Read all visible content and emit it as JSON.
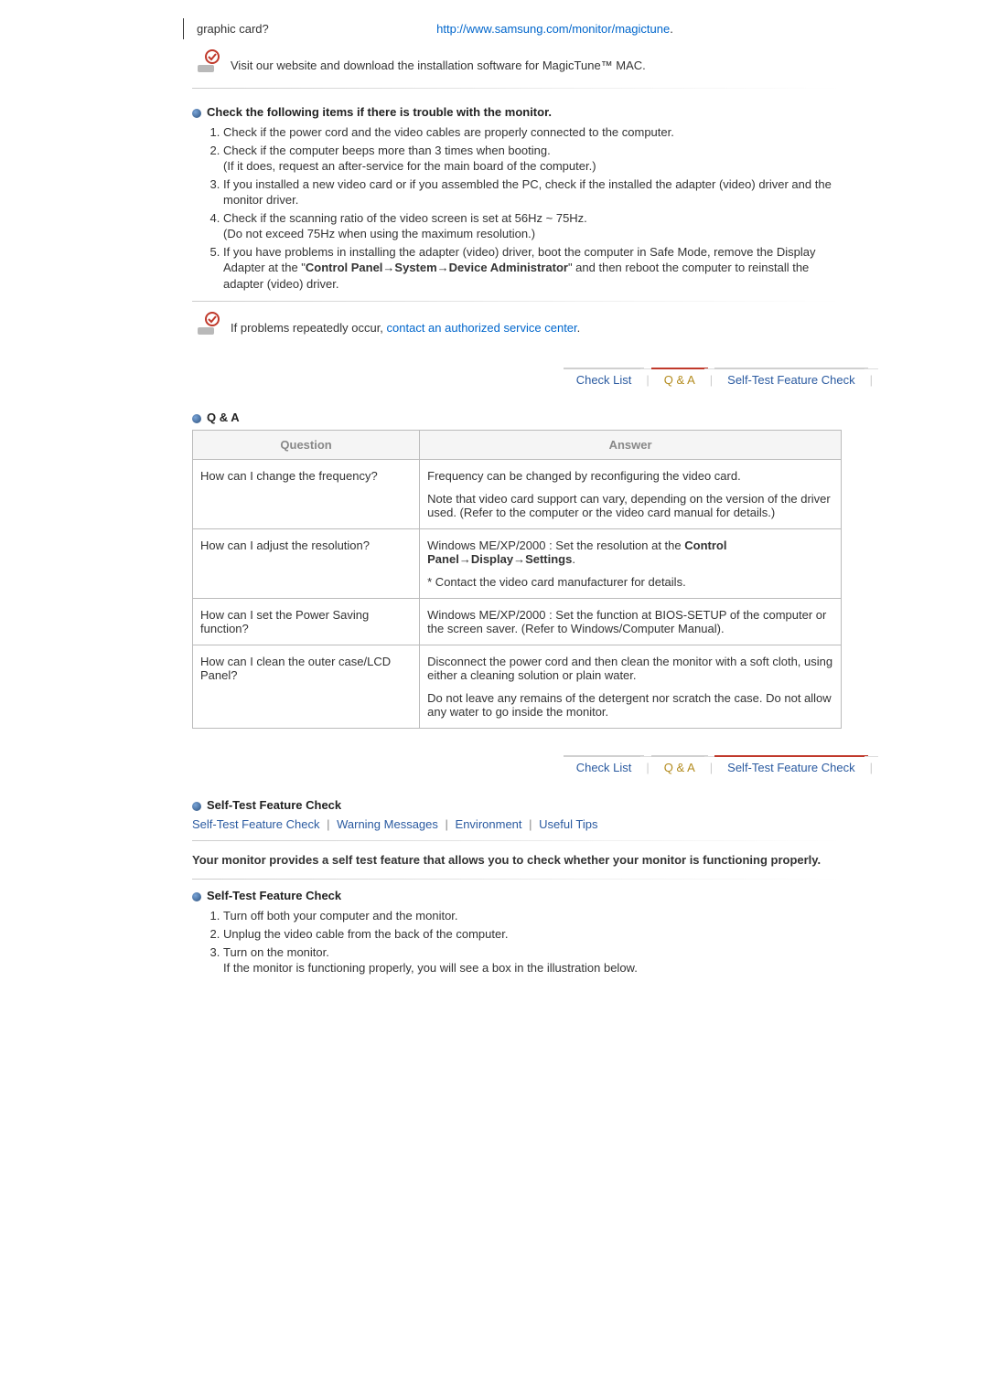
{
  "top_row": {
    "left": "graphic card?",
    "link": "http://www.samsung.com/monitor/magictune",
    "trail": "."
  },
  "mac_note": "Visit our website and download the installation software for MagicTune™ MAC.",
  "check_section": {
    "title": "Check the following items if there is trouble with the monitor.",
    "items": [
      "Check if the power cord and the video cables are properly connected to the computer.",
      "Check if the computer beeps more than 3 times when booting.\n(If it does, request an after-service for the main board of the computer.)",
      "If you installed a new video card or if you assembled the PC, check if the installed the adapter (video) driver and the monitor driver.",
      "Check if the scanning ratio of the video screen is set at 56Hz ~ 75Hz.\n(Do not exceed 75Hz when using the maximum resolution.)",
      "If you have problems in installing the adapter (video) driver, boot the computer in Safe Mode, remove the Display Adapter at the \"Control Panel→System→Device Administrator\" and then reboot the computer to reinstall the adapter (video) driver."
    ],
    "item5_prefix": "If you have problems in installing the adapter (video) driver, boot the computer in Safe Mode, remove the Display Adapter at the \"",
    "item5_bold": "Control Panel→System→Device Administrator",
    "item5_suffix": "\" and then reboot the computer to reinstall the adapter (video) driver."
  },
  "repeat_note_prefix": "If problems repeatedly occur, ",
  "repeat_note_link": "contact an authorized service center",
  "repeat_note_suffix": ".",
  "tabs": {
    "check_list": "Check List",
    "qa": "Q & A",
    "self_test": "Self-Test Feature Check"
  },
  "qa": {
    "title": "Q & A",
    "headers": {
      "q": "Question",
      "a": "Answer"
    },
    "rows": [
      {
        "q": "How can I change the frequency?",
        "a1": "Frequency can be changed by reconfiguring the video card.",
        "a2": "Note that video card support can vary, depending on the version of the driver used. (Refer to the computer or the video card manual for details.)"
      },
      {
        "q": "How can I adjust the resolution?",
        "a1_prefix": "Windows ME/XP/2000 : Set the resolution at the ",
        "a1_bold": "Control Panel→Display→Settings",
        "a1_suffix": ".",
        "a2": "* Contact the video card manufacturer for details."
      },
      {
        "q": "How can I set the Power Saving function?",
        "a1": "Windows ME/XP/2000 : Set the function at BIOS-SETUP of the computer or the screen saver. (Refer to Windows/Computer Manual)."
      },
      {
        "q": "How can I clean the outer case/LCD Panel?",
        "a1": "Disconnect the power cord and then clean the monitor with a soft cloth, using either a cleaning solution or plain water.",
        "a2": "Do not leave any remains of the detergent nor scratch the case. Do not allow any water to go inside the monitor."
      }
    ]
  },
  "selftest": {
    "title": "Self-Test Feature Check",
    "links": {
      "a": "Self-Test Feature Check",
      "b": "Warning Messages",
      "c": "Environment",
      "d": "Useful Tips"
    },
    "intro": "Your monitor provides a self test feature that allows you to check whether your monitor is functioning properly.",
    "subhead": "Self-Test Feature Check",
    "steps": [
      "Turn off both your computer and the monitor.",
      "Unplug the video cable from the back of the computer.",
      "Turn on the monitor."
    ],
    "step3_extra": "If the monitor is functioning properly, you will see a box in the illustration below."
  }
}
